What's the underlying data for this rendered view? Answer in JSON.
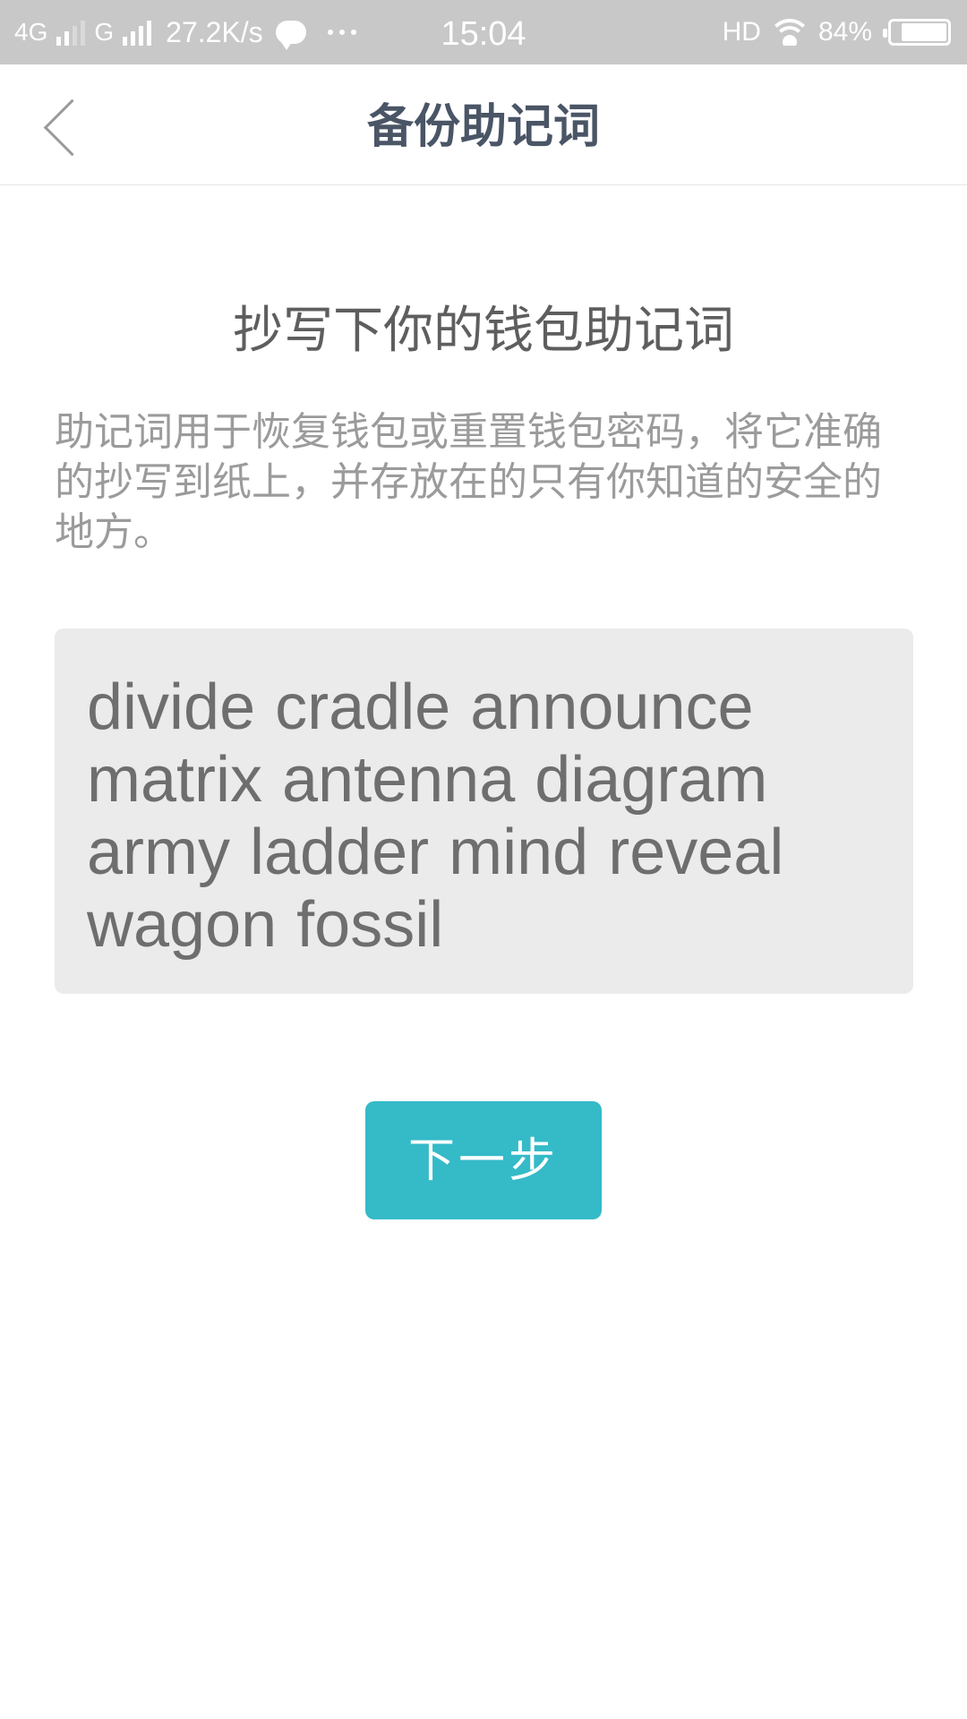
{
  "status_bar": {
    "network_1": "4G",
    "network_2": "G",
    "speed": "27.2K/s",
    "time": "15:04",
    "hd_label": "HD",
    "battery_percent_label": "84%",
    "battery_level": 0.84,
    "icons": [
      "signal-icon",
      "chat-bubble-icon",
      "more-dots-icon",
      "wifi-icon",
      "battery-icon"
    ]
  },
  "nav": {
    "back_icon": "chevron-left-icon",
    "title": "备份助记词"
  },
  "content": {
    "heading": "抄写下你的钱包助记词",
    "description": "助记词用于恢复钱包或重置钱包密码，将它准确的抄写到纸上，并存放在的只有你知道的安全的地方。",
    "mnemonic": "divide cradle announce matrix antenna diagram army ladder mind reveal wagon fossil"
  },
  "actions": {
    "next_label": "下一步"
  },
  "colors": {
    "status_bar_bg": "#c8c8c8",
    "title_text": "#4a5566",
    "heading_text": "#5e5e5e",
    "description_text": "#9b9b9b",
    "mnemonic_bg": "#ebebeb",
    "mnemonic_text": "#6e6e6e",
    "accent": "#35bac8"
  }
}
